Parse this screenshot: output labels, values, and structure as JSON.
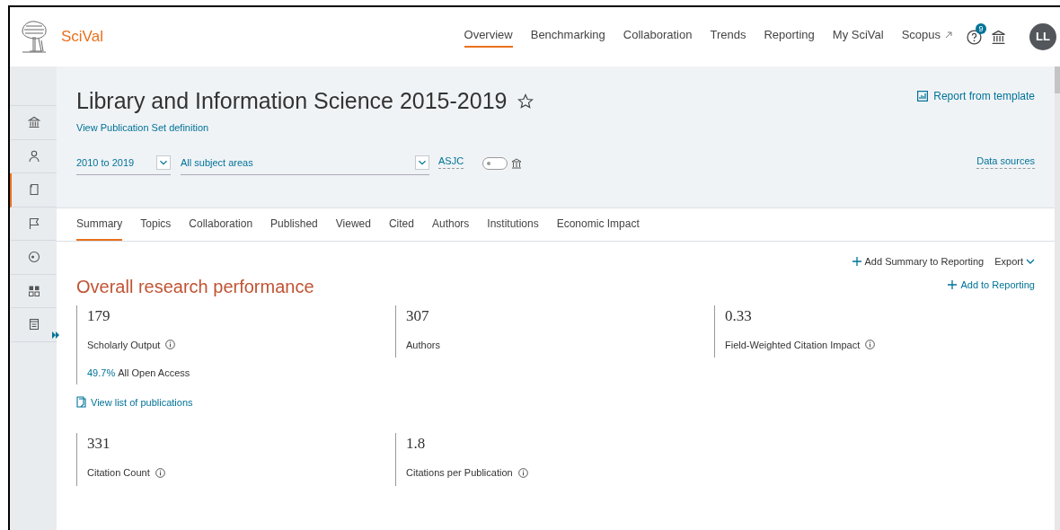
{
  "header": {
    "brand": "SciVal",
    "nav": [
      {
        "label": "Overview",
        "selected": true
      },
      {
        "label": "Benchmarking",
        "selected": false
      },
      {
        "label": "Collaboration",
        "selected": false
      },
      {
        "label": "Trends",
        "selected": false
      },
      {
        "label": "Reporting",
        "selected": false
      },
      {
        "label": "My SciVal",
        "selected": false
      },
      {
        "label": "Scopus",
        "selected": false,
        "external": true
      }
    ],
    "help_badge": "9",
    "avatar": "LL"
  },
  "sidebar": {
    "items": [
      {
        "kind": "institution",
        "selected": false
      },
      {
        "kind": "person",
        "selected": false
      },
      {
        "kind": "document",
        "selected": true
      },
      {
        "kind": "flag",
        "selected": false
      },
      {
        "kind": "target",
        "selected": false
      },
      {
        "kind": "grid",
        "selected": false
      },
      {
        "kind": "report",
        "selected": false
      }
    ]
  },
  "title": "Library and Information Science 2015-2019",
  "definition_link": "View Publication Set definition",
  "report_link": "Report from template",
  "filters": {
    "years": "2010 to 2019",
    "subject": "All subject areas",
    "classification": "ASJC",
    "toggle_on": false,
    "data_sources": "Data sources"
  },
  "tabs": [
    {
      "label": "Summary",
      "selected": true
    },
    {
      "label": "Topics",
      "selected": false
    },
    {
      "label": "Collaboration",
      "selected": false
    },
    {
      "label": "Published",
      "selected": false
    },
    {
      "label": "Viewed",
      "selected": false
    },
    {
      "label": "Cited",
      "selected": false
    },
    {
      "label": "Authors",
      "selected": false
    },
    {
      "label": "Institutions",
      "selected": false
    },
    {
      "label": "Economic Impact",
      "selected": false
    }
  ],
  "actions": {
    "add_summary": "Add Summary to Reporting",
    "export": "Export",
    "add_to_reporting": "Add to Reporting"
  },
  "section_title": "Overall research performance",
  "metric_rows": [
    [
      {
        "value": "179",
        "label": "Scholarly Output",
        "info": true,
        "share": "49.7%",
        "share_label": "All Open Access"
      },
      {
        "value": "307",
        "label": "Authors",
        "info": false
      },
      {
        "value": "0.33",
        "label": "Field-Weighted Citation Impact",
        "info": true
      }
    ],
    [
      {
        "value": "331",
        "label": "Citation Count",
        "info": true
      },
      {
        "value": "1.8",
        "label": "Citations per Publication",
        "info": true
      }
    ]
  ],
  "view_list_link": "View list of publications"
}
